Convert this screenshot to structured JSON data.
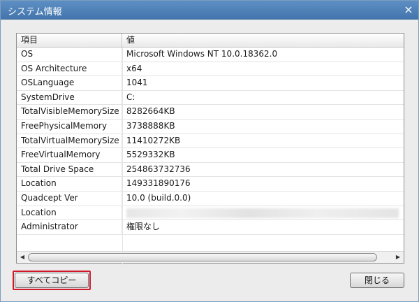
{
  "window": {
    "title": "システム情報",
    "close_glyph": "×"
  },
  "table": {
    "headers": [
      "項目",
      "値"
    ],
    "rows": [
      {
        "key": "OS",
        "value": "Microsoft Windows NT 10.0.18362.0"
      },
      {
        "key": "OS Architecture",
        "value": "x64"
      },
      {
        "key": "OSLanguage",
        "value": "1041"
      },
      {
        "key": "SystemDrive",
        "value": "C:"
      },
      {
        "key": "TotalVisibleMemorySize",
        "value": "8282664KB"
      },
      {
        "key": "FreePhysicalMemory",
        "value": "3738888KB"
      },
      {
        "key": "TotalVirtualMemorySize",
        "value": "11410272KB"
      },
      {
        "key": "FreeVirtualMemory",
        "value": "5529332KB"
      },
      {
        "key": "Total Drive Space",
        "value": "254863732736"
      },
      {
        "key": "Location",
        "value": "149331890176"
      },
      {
        "key": "Quadcept Ver",
        "value": "10.0 (build.0.0)"
      },
      {
        "key": "Location",
        "value": ""
      },
      {
        "key": "Administrator",
        "value": "権限なし"
      }
    ]
  },
  "scrollbar": {
    "left_glyph": "◀",
    "right_glyph": "▶"
  },
  "buttons": {
    "copy_all": "すべてコピー",
    "close": "閉じる"
  },
  "colors": {
    "titlebar": "#4a7db4",
    "highlight": "#d0182a"
  }
}
